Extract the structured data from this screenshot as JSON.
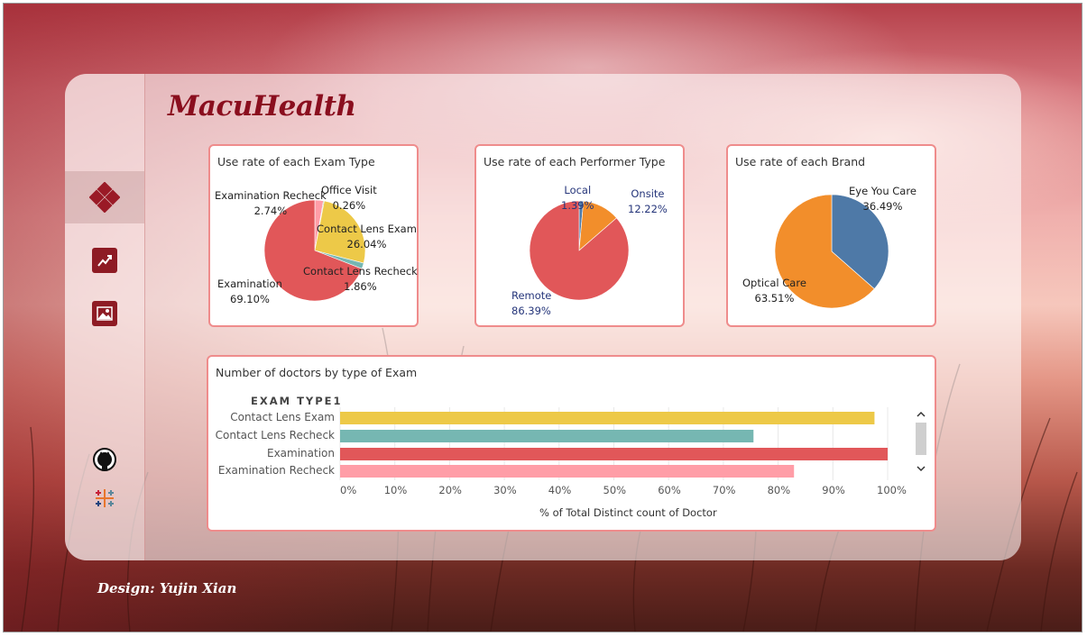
{
  "app": {
    "brand": "MacuHealth",
    "credit": "Design: Yujin Xian"
  },
  "sidebar": {
    "items": [
      {
        "name": "dashboard",
        "active": true
      },
      {
        "name": "trend",
        "active": false
      },
      {
        "name": "image",
        "active": false
      }
    ],
    "links": [
      "github",
      "tableau"
    ]
  },
  "charts": {
    "exam_type": {
      "title": "Use rate of each Exam Type",
      "labels": [
        {
          "name": "Examination Recheck",
          "pct": "2.74%"
        },
        {
          "name": "Office Visit",
          "pct": "0.26%"
        },
        {
          "name": "Contact Lens Exam",
          "pct": "26.04%"
        },
        {
          "name": "Contact Lens Recheck",
          "pct": "1.86%"
        },
        {
          "name": "Examination",
          "pct": "69.10%"
        }
      ]
    },
    "performer_type": {
      "title": "Use rate of each Performer Type",
      "labels": [
        {
          "name": "Local",
          "pct": "1.39%"
        },
        {
          "name": "Onsite",
          "pct": "12.22%"
        },
        {
          "name": "Remote",
          "pct": "86.39%"
        }
      ]
    },
    "brand": {
      "title": "Use rate of each Brand",
      "labels": [
        {
          "name": "Eye You Care",
          "pct": "36.49%"
        },
        {
          "name": "Optical Care",
          "pct": "63.51%"
        }
      ]
    },
    "doctors": {
      "title": "Number of doctors by type of Exam",
      "header": "EXAM TYPE1",
      "xlabel": "% of Total Distinct count of Doctor",
      "ticks": [
        "0%",
        "10%",
        "20%",
        "30%",
        "40%",
        "50%",
        "60%",
        "70%",
        "80%",
        "90%",
        "100%"
      ]
    }
  },
  "chart_data": [
    {
      "type": "pie",
      "categories": [
        "Examination",
        "Examination Recheck",
        "Office Visit",
        "Contact Lens Exam",
        "Contact Lens Recheck"
      ],
      "values": [
        69.1,
        2.74,
        0.26,
        26.04,
        1.86
      ],
      "colors": [
        "#e15759",
        "#ff9da7",
        "#59a14f",
        "#edc948",
        "#76b7b2"
      ]
    },
    {
      "type": "pie",
      "categories": [
        "Local",
        "Onsite",
        "Remote"
      ],
      "values": [
        1.39,
        12.22,
        86.39
      ],
      "colors": [
        "#4e79a7",
        "#f28e2b",
        "#e15759"
      ]
    },
    {
      "type": "pie",
      "categories": [
        "Eye You Care",
        "Optical Care"
      ],
      "values": [
        36.49,
        63.51
      ],
      "colors": [
        "#4e79a7",
        "#f28e2b"
      ]
    },
    {
      "type": "bar",
      "orientation": "horizontal",
      "categories": [
        "Contact Lens Exam",
        "Contact Lens Recheck",
        "Examination",
        "Examination Recheck"
      ],
      "values": [
        97.6,
        75.5,
        100,
        82.9
      ],
      "colors": [
        "#edc948",
        "#76b7b2",
        "#e15759",
        "#ff9da7"
      ],
      "xlim": [
        0,
        100
      ],
      "xlabel": "% of Total Distinct count of Doctor"
    }
  ]
}
